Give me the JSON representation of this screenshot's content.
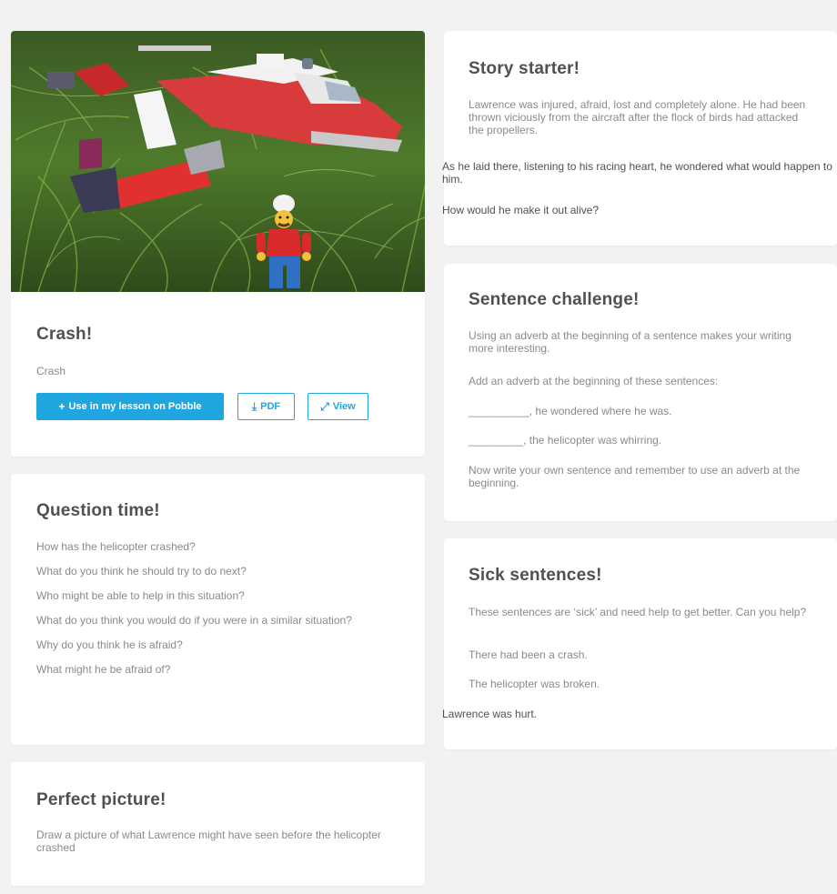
{
  "crash": {
    "title": "Crash!",
    "subtitle": "Crash",
    "use_button": "Use in my lesson on Pobble",
    "use_icon": "plus-icon",
    "pdf_button": "PDF",
    "pdf_icon": "download-icon",
    "view_button": "View",
    "view_icon": "expand-icon",
    "image_alt": "Lego minifigure standing in long grass next to a crashed red and white Lego helicopter"
  },
  "question_time": {
    "title": "Question time!",
    "items": [
      "How has the helicopter crashed?",
      "What do you think he should try to do next?",
      "Who might be able to help in this situation?",
      "What do you think you would do if you were in a similar situation?",
      "Why do you think he is afraid?",
      "What might he be afraid of?"
    ]
  },
  "perfect_picture": {
    "title": "Perfect picture!",
    "text": "Draw a picture of what Lawrence might have seen before the helicopter crashed"
  },
  "story_starter": {
    "title": "Story starter!",
    "p1": "Lawrence was injured, afraid, lost and completely alone. He had been thrown viciously from the aircraft after the flock of birds had attacked the propellers.",
    "p2": "As he laid there, listening to his racing heart, he wondered what would happen to him.",
    "p3": "How would he make it out alive?"
  },
  "sentence_challenge": {
    "title": "Sentence challenge!",
    "p1": "Using an adverb at the beginning of a sentence makes your writing more interesting.",
    "p2": "Add an adverb at the beginning of these sentences:",
    "p3": "__________, he wondered where he was.",
    "p4": "_________, the helicopter was whirring.",
    "p5": "Now write your own sentence and remember to use an adverb at the beginning."
  },
  "sick_sentences": {
    "title": "Sick sentences!",
    "p1": "These sentences are ‘sick’ and need help to get better. Can you help?",
    "p2": "There had been a crash.",
    "p3": "The helicopter was broken.",
    "p4": "Lawrence was hurt."
  },
  "colors": {
    "accent": "#1fa6e0",
    "background": "#f2f2f2",
    "card": "#ffffff",
    "heading": "#505050",
    "body": "#8a8a8a"
  }
}
